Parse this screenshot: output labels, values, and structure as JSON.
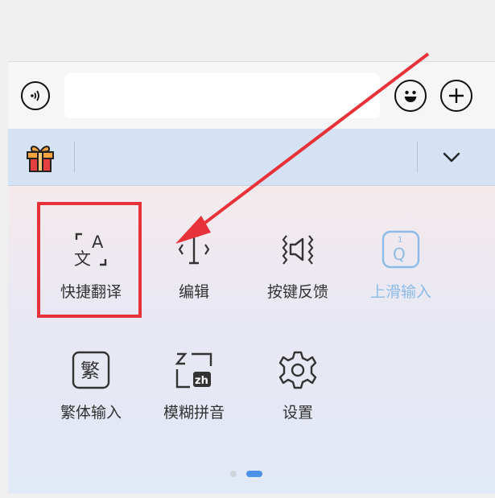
{
  "input_bar": {
    "text_value": ""
  },
  "grid": {
    "items": [
      {
        "label": "快捷翻译",
        "icon": "translate-icon"
      },
      {
        "label": "编辑",
        "icon": "edit-cursor-icon"
      },
      {
        "label": "按键反馈",
        "icon": "key-feedback-icon"
      },
      {
        "label": "上滑输入",
        "icon": "swipe-up-input-icon"
      },
      {
        "label": "繁体输入",
        "icon": "traditional-chinese-icon"
      },
      {
        "label": "模糊拼音",
        "icon": "fuzzy-pinyin-icon"
      },
      {
        "label": "设置",
        "icon": "gear-icon"
      }
    ],
    "繁_char": "繁",
    "q_char": "Q",
    "q_num": "1",
    "zh_text": "zh",
    "a_char": "A",
    "wen_char": "文"
  },
  "pager": {
    "pages": 2,
    "current": 2
  },
  "colors": {
    "highlight": "#e8323a",
    "arrow": "#e8323a",
    "toolbar_bg": "#d5e2f3",
    "active_dot": "#4a93e6",
    "disabled_label": "#8dbbe8"
  }
}
